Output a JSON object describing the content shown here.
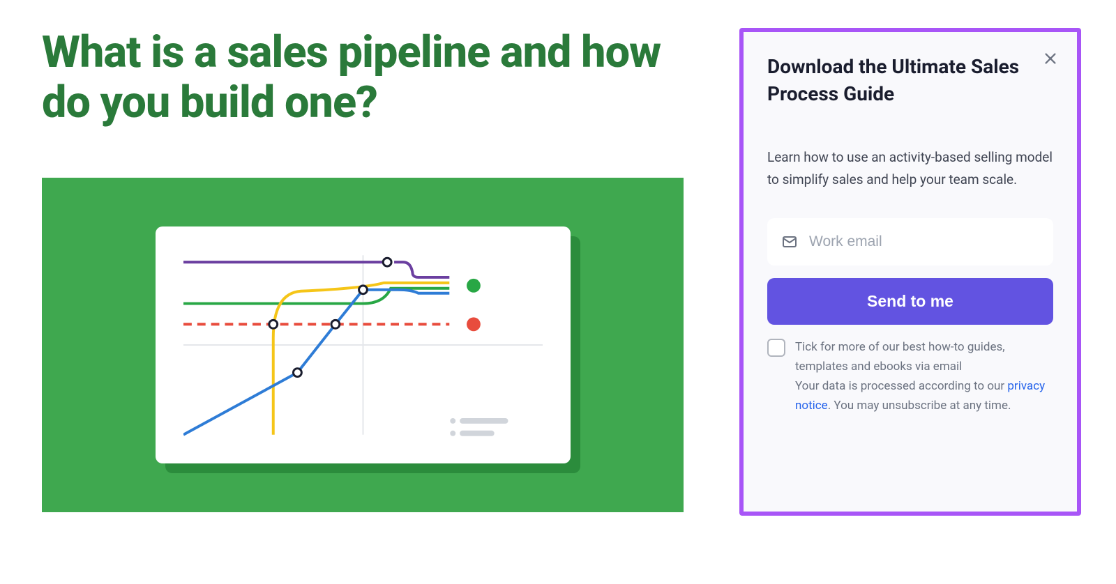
{
  "main": {
    "title": "What is a sales pipeline and how do you build one?"
  },
  "sidebar": {
    "title": "Download the Ultimate Sales Process Guide",
    "description": "Learn how to use an activity-based selling model to simplify sales and help your team scale.",
    "email_placeholder": "Work email",
    "submit_label": "Send to me",
    "consent_label": "Tick for more of our best how-to guides, templates and ebooks via email",
    "privacy_prefix": "Your data is processed according to our ",
    "privacy_link_text": "privacy notice",
    "privacy_suffix": ". You may unsubscribe at any time."
  },
  "colors": {
    "title_green": "#2a7a3a",
    "hero_green": "#3fa84f",
    "accent_purple": "#a855f7",
    "button_indigo": "#6253e1"
  }
}
